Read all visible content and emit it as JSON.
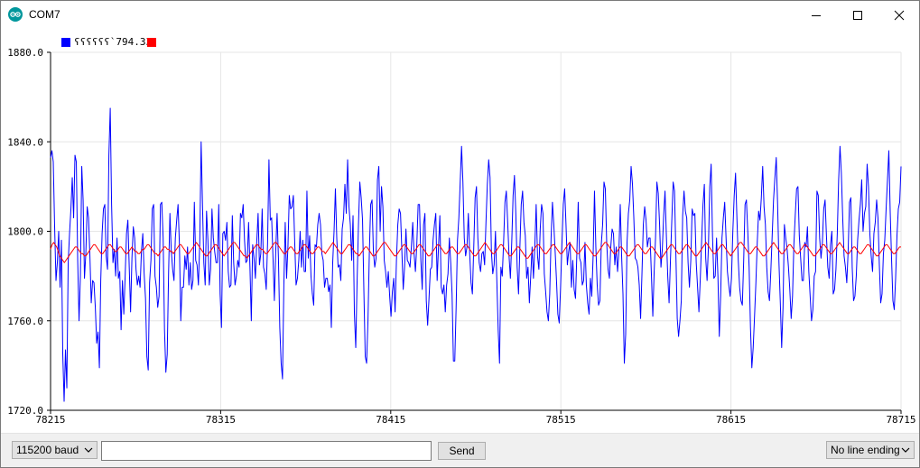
{
  "window": {
    "title": "COM7",
    "minimize_glyph": "—",
    "maximize_glyph": "☐",
    "close_glyph": "✕"
  },
  "legend": {
    "series1_label": "ʕʕʕʕʕʕ`794.33",
    "series1_color": "#0000ff",
    "series2_color": "#ff0000"
  },
  "controls": {
    "baud_rate": "115200 baud",
    "send_label": "Send",
    "message_value": "",
    "line_ending": "No line ending"
  },
  "chart_data": {
    "type": "line",
    "xlim": [
      78215,
      78715
    ],
    "ylim": [
      1720,
      1880
    ],
    "x_ticks": [
      "78215",
      "78315",
      "78415",
      "78515",
      "78615",
      "78715"
    ],
    "y_ticks": [
      "1880.0",
      "1840.0",
      "1800.0",
      "1760.0",
      "1720.0"
    ],
    "grid": true,
    "series": [
      {
        "color": "#0000ff",
        "start_x": 78215,
        "values": [
          1833,
          1836,
          1831,
          1802,
          1778,
          1786,
          1800,
          1775,
          1796,
          1745,
          1724,
          1747,
          1730,
          1786,
          1799,
          1810,
          1824,
          1806,
          1834,
          1831,
          1787,
          1760,
          1780,
          1829,
          1814,
          1779,
          1790,
          1811,
          1806,
          1789,
          1768,
          1778,
          1777,
          1766,
          1750,
          1755,
          1739,
          1778,
          1799,
          1810,
          1812,
          1789,
          1783,
          1834,
          1855,
          1812,
          1786,
          1792,
          1780,
          1797,
          1779,
          1782,
          1756,
          1778,
          1763,
          1780,
          1799,
          1805,
          1784,
          1764,
          1788,
          1802,
          1797,
          1783,
          1776,
          1780,
          1775,
          1791,
          1799,
          1781,
          1770,
          1744,
          1738,
          1777,
          1787,
          1810,
          1812,
          1780,
          1775,
          1766,
          1771,
          1812,
          1813,
          1797,
          1756,
          1737,
          1745,
          1781,
          1808,
          1791,
          1783,
          1778,
          1797,
          1805,
          1812,
          1794,
          1760,
          1775,
          1775,
          1789,
          1783,
          1793,
          1776,
          1786,
          1774,
          1778,
          1813,
          1787,
          1785,
          1776,
          1795,
          1840,
          1812,
          1786,
          1776,
          1809,
          1796,
          1776,
          1783,
          1810,
          1797,
          1791,
          1786,
          1786,
          1812,
          1772,
          1757,
          1799,
          1800,
          1796,
          1804,
          1782,
          1775,
          1776,
          1807,
          1786,
          1776,
          1780,
          1787,
          1784,
          1808,
          1806,
          1812,
          1796,
          1786,
          1787,
          1804,
          1784,
          1760,
          1794,
          1788,
          1779,
          1795,
          1808,
          1785,
          1790,
          1810,
          1784,
          1781,
          1774,
          1795,
          1832,
          1805,
          1806,
          1788,
          1769,
          1791,
          1808,
          1788,
          1757,
          1741,
          1734,
          1776,
          1804,
          1779,
          1793,
          1816,
          1810,
          1811,
          1816,
          1795,
          1776,
          1779,
          1787,
          1800,
          1784,
          1796,
          1782,
          1782,
          1818,
          1788,
          1798,
          1780,
          1772,
          1767,
          1794,
          1793,
          1803,
          1808,
          1803,
          1790,
          1787,
          1775,
          1779,
          1779,
          1773,
          1776,
          1757,
          1786,
          1800,
          1819,
          1797,
          1784,
          1785,
          1778,
          1801,
          1806,
          1821,
          1808,
          1832,
          1811,
          1803,
          1787,
          1807,
          1763,
          1748,
          1778,
          1803,
          1822,
          1815,
          1805,
          1773,
          1744,
          1741,
          1760,
          1790,
          1812,
          1814,
          1791,
          1784,
          1788,
          1823,
          1829,
          1800,
          1820,
          1811,
          1787,
          1782,
          1775,
          1782,
          1771,
          1762,
          1773,
          1779,
          1764,
          1787,
          1803,
          1810,
          1808,
          1791,
          1774,
          1784,
          1801,
          1787,
          1786,
          1784,
          1793,
          1804,
          1790,
          1782,
          1794,
          1812,
          1812,
          1787,
          1774,
          1803,
          1808,
          1769,
          1758,
          1770,
          1783,
          1784,
          1796,
          1803,
          1808,
          1778,
          1793,
          1807,
          1775,
          1772,
          1776,
          1764,
          1776,
          1781,
          1797,
          1786,
          1772,
          1742,
          1742,
          1766,
          1796,
          1806,
          1822,
          1838,
          1822,
          1797,
          1789,
          1793,
          1808,
          1790,
          1777,
          1772,
          1793,
          1815,
          1820,
          1797,
          1786,
          1782,
          1790,
          1791,
          1785,
          1804,
          1821,
          1832,
          1824,
          1791,
          1781,
          1785,
          1800,
          1778,
          1756,
          1741,
          1784,
          1780,
          1795,
          1813,
          1818,
          1804,
          1789,
          1779,
          1795,
          1816,
          1825,
          1808,
          1784,
          1772,
          1793,
          1812,
          1818,
          1804,
          1798,
          1779,
          1784,
          1768,
          1780,
          1793,
          1779,
          1793,
          1812,
          1789,
          1783,
          1801,
          1812,
          1808,
          1781,
          1773,
          1764,
          1760,
          1772,
          1797,
          1813,
          1803,
          1791,
          1778,
          1763,
          1759,
          1775,
          1794,
          1812,
          1819,
          1803,
          1785,
          1791,
          1795,
          1775,
          1787,
          1774,
          1770,
          1790,
          1813,
          1788,
          1786,
          1776,
          1778,
          1795,
          1776,
          1768,
          1763,
          1779,
          1771,
          1789,
          1818,
          1793,
          1776,
          1767,
          1769,
          1794,
          1803,
          1822,
          1819,
          1795,
          1783,
          1779,
          1793,
          1801,
          1799,
          1785,
          1793,
          1782,
          1791,
          1812,
          1789,
          1772,
          1741,
          1754,
          1795,
          1808,
          1814,
          1829,
          1821,
          1806,
          1788,
          1787,
          1784,
          1776,
          1761,
          1781,
          1803,
          1811,
          1805,
          1793,
          1797,
          1797,
          1780,
          1762,
          1782,
          1797,
          1822,
          1817,
          1803,
          1784,
          1792,
          1807,
          1818,
          1798,
          1780,
          1768,
          1787,
          1805,
          1822,
          1818,
          1790,
          1761,
          1753,
          1760,
          1769,
          1807,
          1818,
          1809,
          1806,
          1786,
          1775,
          1787,
          1810,
          1807,
          1808,
          1786,
          1775,
          1764,
          1779,
          1796,
          1812,
          1821,
          1788,
          1778,
          1793,
          1820,
          1830,
          1798,
          1779,
          1780,
          1797,
          1780,
          1753,
          1771,
          1797,
          1806,
          1813,
          1797,
          1782,
          1776,
          1771,
          1779,
          1800,
          1816,
          1826,
          1806,
          1787,
          1775,
          1769,
          1767,
          1787,
          1812,
          1814,
          1800,
          1784,
          1757,
          1739,
          1748,
          1762,
          1777,
          1795,
          1809,
          1805,
          1815,
          1829,
          1811,
          1803,
          1784,
          1773,
          1769,
          1782,
          1798,
          1814,
          1824,
          1833,
          1812,
          1786,
          1768,
          1748,
          1766,
          1803,
          1797,
          1792,
          1784,
          1774,
          1761,
          1771,
          1794,
          1807,
          1819,
          1820,
          1798,
          1788,
          1778,
          1778,
          1795,
          1793,
          1802,
          1782,
          1771,
          1760,
          1765,
          1780,
          1782,
          1818,
          1816,
          1797,
          1788,
          1795,
          1810,
          1814,
          1798,
          1784,
          1779,
          1794,
          1800,
          1772,
          1774,
          1783,
          1799,
          1823,
          1838,
          1826,
          1806,
          1789,
          1784,
          1777,
          1791,
          1813,
          1815,
          1784,
          1769,
          1771,
          1780,
          1796,
          1805,
          1812,
          1823,
          1800,
          1808,
          1811,
          1830,
          1820,
          1799,
          1789,
          1782,
          1799,
          1804,
          1814,
          1806,
          1785,
          1768,
          1772,
          1790,
          1796,
          1810,
          1823,
          1836,
          1809,
          1788,
          1769,
          1765,
          1779,
          1798,
          1810,
          1813,
          1829
        ]
      },
      {
        "color": "#ff0000",
        "start_x": 78215,
        "values": [
          1792,
          1794,
          1795,
          1794,
          1793,
          1791,
          1789,
          1788,
          1787,
          1786,
          1787,
          1788,
          1789,
          1790,
          1791,
          1792,
          1793,
          1793,
          1792,
          1791,
          1790,
          1790,
          1789,
          1789,
          1790,
          1791,
          1792,
          1793,
          1794,
          1794,
          1793,
          1792,
          1791,
          1790,
          1790,
          1791,
          1792,
          1793,
          1794,
          1794,
          1793,
          1792,
          1791,
          1791,
          1792,
          1793,
          1793,
          1792,
          1791,
          1790,
          1790,
          1791,
          1792,
          1793,
          1792,
          1791,
          1791,
          1790,
          1790,
          1791,
          1792,
          1792,
          1793,
          1794,
          1794,
          1793,
          1792,
          1791,
          1790,
          1790,
          1789,
          1790,
          1791,
          1792,
          1793,
          1793,
          1792,
          1792,
          1791,
          1791,
          1790,
          1791,
          1792,
          1793,
          1794,
          1794,
          1793,
          1792,
          1791,
          1790,
          1790,
          1791,
          1792,
          1793,
          1794,
          1795,
          1794,
          1793,
          1792,
          1791,
          1790,
          1789,
          1789,
          1790,
          1791,
          1792,
          1793,
          1794,
          1794,
          1793,
          1792,
          1791,
          1790,
          1789,
          1790,
          1791,
          1792,
          1793,
          1794,
          1795,
          1795,
          1794,
          1793,
          1792,
          1791,
          1790,
          1789,
          1789,
          1788,
          1789,
          1790,
          1791,
          1792,
          1793,
          1794,
          1794,
          1793,
          1792,
          1792,
          1791,
          1790,
          1790,
          1791,
          1792,
          1793,
          1794,
          1795,
          1795,
          1794,
          1793,
          1792,
          1791,
          1790,
          1790,
          1791,
          1792,
          1793,
          1793,
          1792,
          1791,
          1790,
          1790,
          1791,
          1792,
          1793,
          1794,
          1794,
          1793,
          1792,
          1791,
          1790,
          1790,
          1791,
          1792,
          1793,
          1793,
          1792,
          1791,
          1791,
          1790,
          1791,
          1792,
          1793,
          1794,
          1795,
          1794,
          1793,
          1792,
          1791,
          1790,
          1790,
          1791,
          1792,
          1793,
          1794,
          1794,
          1793,
          1792,
          1791,
          1790,
          1790,
          1789,
          1790,
          1791,
          1792,
          1793,
          1793,
          1792,
          1791,
          1790,
          1789,
          1789,
          1790,
          1791,
          1792,
          1793,
          1794,
          1795,
          1795,
          1794,
          1793,
          1792,
          1791,
          1790,
          1789,
          1789,
          1790,
          1791,
          1792,
          1793,
          1794,
          1794,
          1793,
          1792,
          1791,
          1790,
          1790,
          1791,
          1792,
          1793,
          1794,
          1794,
          1793,
          1792,
          1791,
          1790,
          1789,
          1789,
          1790,
          1791,
          1792,
          1793,
          1794,
          1794,
          1793,
          1792,
          1791,
          1790,
          1790,
          1791,
          1792,
          1793,
          1793,
          1792,
          1791,
          1790,
          1790,
          1791,
          1792,
          1793,
          1794,
          1794,
          1793,
          1792,
          1791,
          1790,
          1789,
          1789,
          1790,
          1791,
          1792,
          1793,
          1794,
          1795,
          1794,
          1793,
          1792,
          1791,
          1790,
          1790,
          1791,
          1792,
          1793,
          1794,
          1794,
          1793,
          1792,
          1791,
          1790,
          1789,
          1789,
          1790,
          1791,
          1792,
          1793,
          1793,
          1792,
          1791,
          1790,
          1789,
          1788,
          1788,
          1789,
          1790,
          1791,
          1792,
          1793,
          1794,
          1794,
          1793,
          1792,
          1791,
          1790,
          1790,
          1791,
          1792,
          1793,
          1794,
          1794,
          1793,
          1792,
          1791,
          1790,
          1790,
          1791,
          1792,
          1793,
          1794,
          1795,
          1794,
          1793,
          1792,
          1791,
          1790,
          1790,
          1791,
          1792,
          1793,
          1794,
          1794,
          1793,
          1792,
          1791,
          1790,
          1789,
          1789,
          1790,
          1791,
          1792,
          1793,
          1794,
          1795,
          1795,
          1794,
          1793,
          1792,
          1791,
          1790,
          1790,
          1791,
          1792,
          1793,
          1793,
          1792,
          1791,
          1790,
          1789,
          1789,
          1790,
          1791,
          1792,
          1793,
          1794,
          1794,
          1793,
          1792,
          1791,
          1790,
          1790,
          1791,
          1792,
          1793,
          1793,
          1792,
          1791,
          1790,
          1789,
          1788,
          1788,
          1789,
          1790,
          1791,
          1792,
          1793,
          1794,
          1794,
          1793,
          1792,
          1791,
          1790,
          1790,
          1791,
          1792,
          1793,
          1794,
          1794,
          1793,
          1792,
          1791,
          1790,
          1789,
          1789,
          1790,
          1791,
          1792,
          1793,
          1794,
          1795,
          1794,
          1793,
          1792,
          1791,
          1790,
          1790,
          1791,
          1792,
          1793,
          1794,
          1794,
          1793,
          1792,
          1791,
          1790,
          1789,
          1790,
          1791,
          1792,
          1793,
          1794,
          1795,
          1795,
          1794,
          1793,
          1792,
          1791,
          1790,
          1790,
          1791,
          1792,
          1793,
          1793,
          1792,
          1791,
          1790,
          1789,
          1789,
          1790,
          1791,
          1792,
          1793,
          1794,
          1795,
          1794,
          1793,
          1792,
          1791,
          1790,
          1790,
          1791,
          1792,
          1793,
          1794,
          1794,
          1793,
          1792,
          1791,
          1790,
          1790,
          1791,
          1792,
          1793,
          1794,
          1794,
          1793,
          1792,
          1791,
          1790,
          1789,
          1789,
          1790,
          1791,
          1792,
          1793,
          1794,
          1794,
          1793,
          1792,
          1791,
          1790,
          1790,
          1791,
          1792,
          1793,
          1794,
          1795,
          1794,
          1793,
          1792,
          1791,
          1790,
          1790,
          1791,
          1792,
          1793,
          1793,
          1792,
          1791,
          1790,
          1790,
          1791,
          1792,
          1793,
          1794,
          1794,
          1793,
          1792,
          1791,
          1790,
          1789,
          1789,
          1790,
          1791,
          1792,
          1793,
          1794,
          1794,
          1793,
          1792,
          1791,
          1790,
          1790,
          1791,
          1792,
          1793,
          1793
        ]
      }
    ]
  }
}
